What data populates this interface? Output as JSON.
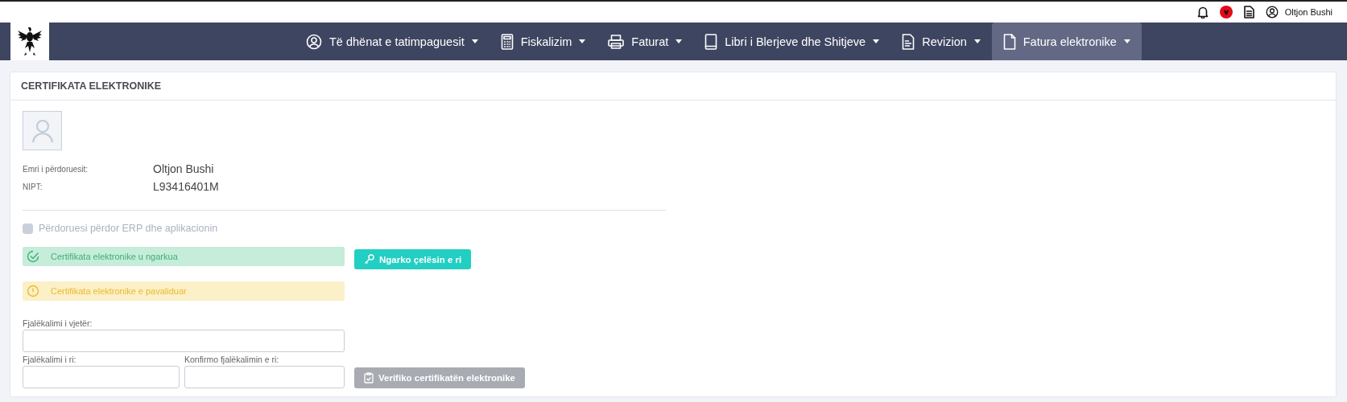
{
  "topbar": {
    "user": "Oltjon Bushi"
  },
  "nav": [
    {
      "label": "Të dhënat e tatimpaguesit",
      "selected": false
    },
    {
      "label": "Fiskalizim",
      "selected": false
    },
    {
      "label": "Faturat",
      "selected": false
    },
    {
      "label": "Libri i Blerjeve dhe Shitjeve",
      "selected": false
    },
    {
      "label": "Revizion",
      "selected": false
    },
    {
      "label": "Fatura elektronike",
      "selected": true
    }
  ],
  "card": {
    "title": "CERTIFIKATA ELEKTRONIKE",
    "fields": [
      {
        "label": "Emri i përdoruesit:",
        "value": "Oltjon Bushi"
      },
      {
        "label": "NIPT:",
        "value": "L93416401M"
      }
    ],
    "checkbox": {
      "label": "Përdoruesi përdor ERP dhe aplikacionin",
      "checked": false,
      "disabled": true
    },
    "alerts": [
      {
        "kind": "success",
        "text": "Certifikata elektronike u ngarkua"
      },
      {
        "kind": "warning",
        "text": "Certifikata elektronike e pavaliduar"
      }
    ],
    "upload_button": {
      "label": "Ngarko çelësin e ri"
    },
    "password_fields": [
      {
        "label": "Fjalëkalimi i vjetër:"
      },
      {
        "label": "Fjalëkalimi i ri:"
      },
      {
        "label": "Konfirmo fjalëkalimin e ri:"
      }
    ],
    "verify_button": {
      "label": "Verifiko certifikatën elektronike",
      "disabled": true
    }
  }
}
